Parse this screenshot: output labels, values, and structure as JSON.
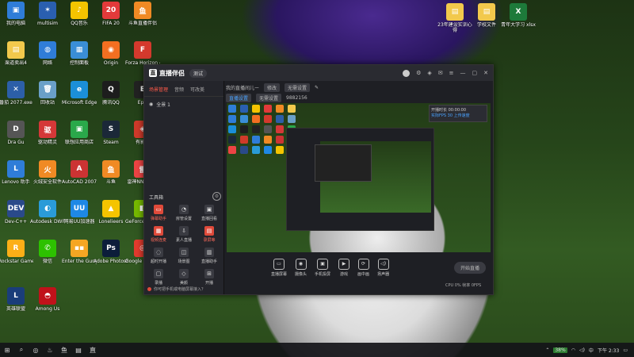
{
  "desktop": {
    "left_icons": [
      {
        "label": "我的电脑",
        "color": "#2f7dd8",
        "glyph": "▣"
      },
      {
        "label": "multisim",
        "color": "#2a5fb0",
        "glyph": "✶"
      },
      {
        "label": "QQ音乐",
        "color": "#f4c400",
        "glyph": "♪"
      },
      {
        "label": "FIFA 20",
        "color": "#e23a3a",
        "glyph": "20"
      },
      {
        "label": "斗鱼直播伴侣",
        "color": "#f08a24",
        "glyph": "鱼"
      },
      {
        "label": "渠道卖出4",
        "color": "#f2c94c",
        "glyph": "▤"
      },
      {
        "label": "网络",
        "color": "#2f7dd8",
        "glyph": "◍"
      },
      {
        "label": "控制面板",
        "color": "#3a8ed6",
        "glyph": "▦"
      },
      {
        "label": "Origin",
        "color": "#f36f21",
        "glyph": "◉"
      },
      {
        "label": "Forza Horizon 4",
        "color": "#d4392d",
        "glyph": "F"
      },
      {
        "label": "番茄 2077.exe",
        "color": "#2c5fa8",
        "glyph": "✕"
      },
      {
        "label": "回收站",
        "color": "#6aa0c8",
        "glyph": "🗑"
      },
      {
        "label": "Microsoft Edge",
        "color": "#1b8fd8",
        "glyph": "e"
      },
      {
        "label": "腾讯QQ",
        "color": "#1d1d1d",
        "glyph": "Q"
      },
      {
        "label": "Epic",
        "color": "#222222",
        "glyph": "E"
      },
      {
        "label": "Dra Gu",
        "color": "#555555",
        "glyph": "D"
      },
      {
        "label": "驱动精灵",
        "color": "#d43838",
        "glyph": "驱"
      },
      {
        "label": "联想应用商店",
        "color": "#2aa84a",
        "glyph": "▣"
      },
      {
        "label": "Steam",
        "color": "#1b2838",
        "glyph": "S"
      },
      {
        "label": "有影行",
        "color": "#d03a2a",
        "glyph": "◈"
      },
      {
        "label": "Lenovo 助手",
        "color": "#2f7dd8",
        "glyph": "L"
      },
      {
        "label": "火绒安全软件",
        "color": "#f08a24",
        "glyph": "火"
      },
      {
        "label": "AutoCAD 2007",
        "color": "#c33",
        "glyph": "A"
      },
      {
        "label": "斗鱼",
        "color": "#f08a24",
        "glyph": "鱼"
      },
      {
        "label": "雷神NN加速器",
        "color": "#e44",
        "glyph": "雷"
      },
      {
        "label": "Dev-C++",
        "color": "#2a4a8a",
        "glyph": "DEV"
      },
      {
        "label": "Autodesk DWF Viewer",
        "color": "#2a9bd8",
        "glyph": "◐"
      },
      {
        "label": "网易UU加速器",
        "color": "#1e88e5",
        "glyph": "UU"
      },
      {
        "label": "Lonelieers",
        "color": "#f5c400",
        "glyph": "▲"
      },
      {
        "label": "GeForce Experience",
        "color": "#76b900",
        "glyph": "◧"
      },
      {
        "label": "Rockstar Games ...",
        "color": "#fcaf17",
        "glyph": "R"
      },
      {
        "label": "微信",
        "color": "#2dc100",
        "glyph": "✆"
      },
      {
        "label": "Enter the Gungeon",
        "color": "#f5a623",
        "glyph": "▪▪"
      },
      {
        "label": "Adobe Photosh...",
        "color": "#0c1d3a",
        "glyph": "Ps"
      },
      {
        "label": "Google Chrome",
        "color": "#e33b2e",
        "glyph": "◎"
      },
      {
        "label": "英雄联盟",
        "color": "#1a3d7a",
        "glyph": "L"
      },
      {
        "label": "Among Us",
        "color": "#c0121a",
        "glyph": "◓"
      }
    ],
    "right_icons": [
      {
        "label": "23年建设实训心得",
        "color": "#f2c94c",
        "glyph": "▤"
      },
      {
        "label": "学校文件",
        "color": "#f2c94c",
        "glyph": "▤"
      },
      {
        "label": "青年大学习 xlsx",
        "color": "#1d7a3a",
        "glyph": "X"
      }
    ]
  },
  "app": {
    "title": "直播伴侣",
    "version_badge": "测试",
    "left_tabs": [
      "场景管理",
      "音频",
      "可改美"
    ],
    "scene_name": "全景 1",
    "tools_title": "工具箱",
    "tools": [
      {
        "label": "弹幕助手",
        "glyph": "▭",
        "red": true
      },
      {
        "label": "房管设置",
        "glyph": "◔",
        "red": false
      },
      {
        "label": "直播回看",
        "glyph": "▣",
        "red": false
      },
      {
        "label": "视频连麦",
        "glyph": "▦",
        "red": true
      },
      {
        "label": "素人直播",
        "glyph": "⇩",
        "red": false
      },
      {
        "label": "录屏等",
        "glyph": "▤",
        "red": true
      },
      {
        "label": "超时开播",
        "glyph": "◌",
        "red": false
      },
      {
        "label": "场景图",
        "glyph": "◫",
        "red": false
      },
      {
        "label": "直播助手",
        "glyph": "▥",
        "red": false
      },
      {
        "label": "录播",
        "glyph": "▢",
        "red": false
      },
      {
        "label": "美颜",
        "glyph": "◇",
        "red": false
      },
      {
        "label": "开播",
        "glyph": "⊞",
        "red": false
      }
    ],
    "bottom_hint": "你可把手机或电脑屏幕接入？",
    "toolbar_row1": {
      "stream_title": "我的直播间儿ー",
      "tag": "修改",
      "extra": "无需设置"
    },
    "toolbar_row2": {
      "tag1": "直播设置",
      "tag2": "无需设置",
      "id_label": "9882156"
    },
    "status_card": {
      "line1": "开播时长 00:00:00",
      "line2": "实际FPS 30 上传速度"
    },
    "controls": [
      {
        "label": "直播屏幕",
        "glyph": "▭"
      },
      {
        "label": "摄像头",
        "glyph": "◉"
      },
      {
        "label": "手机投屏",
        "glyph": "▣"
      },
      {
        "label": "游戏",
        "glyph": "▶"
      },
      {
        "label": "画中画",
        "glyph": "⟳"
      },
      {
        "label": "扬声器",
        "glyph": "◁)"
      }
    ],
    "start_button": "开始直播",
    "bottom_stats": "CPU 0%  帧率 0FPS"
  },
  "taskbar": {
    "battery": "38%",
    "time": "下午 2:33",
    "lang": "中"
  }
}
